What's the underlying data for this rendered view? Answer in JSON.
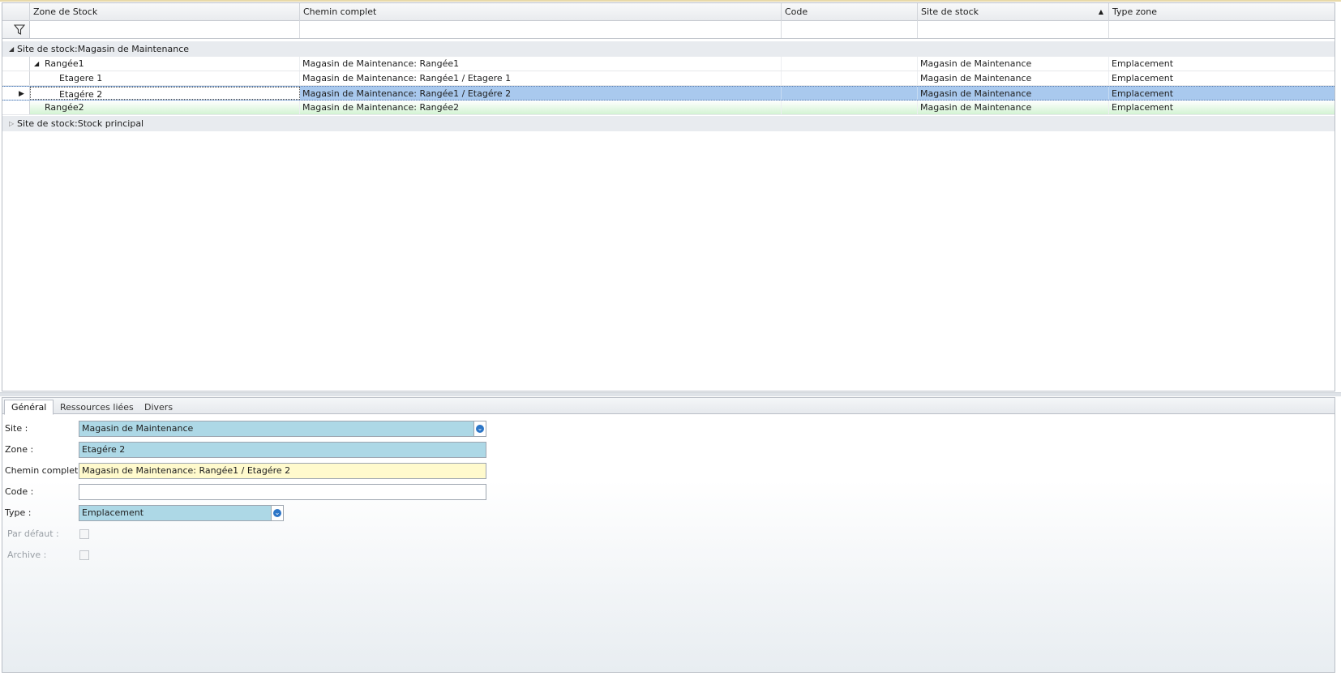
{
  "grid": {
    "columns": [
      {
        "label": "Zone de Stock"
      },
      {
        "label": "Chemin complet"
      },
      {
        "label": "Code"
      },
      {
        "label": "Site de stock"
      },
      {
        "label": "Type zone"
      }
    ],
    "groups": [
      {
        "label": "Site de stock:Magasin de Maintenance"
      },
      {
        "label": "Site de stock:Stock principal"
      }
    ],
    "rows": [
      {
        "zone": "Rangée1",
        "chemin": "Magasin de Maintenance: Rangée1",
        "code": "",
        "site": "Magasin de Maintenance",
        "type": "Emplacement"
      },
      {
        "zone": "Etagere 1",
        "chemin": "Magasin de Maintenance: Rangée1 / Etagere 1",
        "code": "",
        "site": "Magasin de Maintenance",
        "type": "Emplacement"
      },
      {
        "zone": "Etagére 2",
        "chemin": "Magasin de Maintenance: Rangée1 / Etagére 2",
        "code": "",
        "site": "Magasin de Maintenance",
        "type": "Emplacement"
      },
      {
        "zone": "Rangée2",
        "chemin": "Magasin de Maintenance: Rangée2",
        "code": "",
        "site": "Magasin de Maintenance",
        "type": "Emplacement"
      }
    ]
  },
  "tabs": [
    {
      "label": "Général"
    },
    {
      "label": "Ressources liées"
    },
    {
      "label": "Divers"
    }
  ],
  "form": {
    "site_label": "Site :",
    "site_value": "Magasin de Maintenance",
    "zone_label": "Zone :",
    "zone_value": "Etagére 2",
    "chemin_label": "Chemin complet :",
    "chemin_value": "Magasin de Maintenance: Rangée1 / Etagére 2",
    "code_label": "Code :",
    "code_value": "",
    "type_label": "Type :",
    "type_value": "Emplacement",
    "defaut_label": "Par défaut :",
    "archive_label": "Archive :"
  },
  "colors": {
    "selection": "#a9c9ee",
    "field_blue": "#add8e6",
    "field_yellow": "#fffacd",
    "row_green": "#d3f3d3"
  }
}
